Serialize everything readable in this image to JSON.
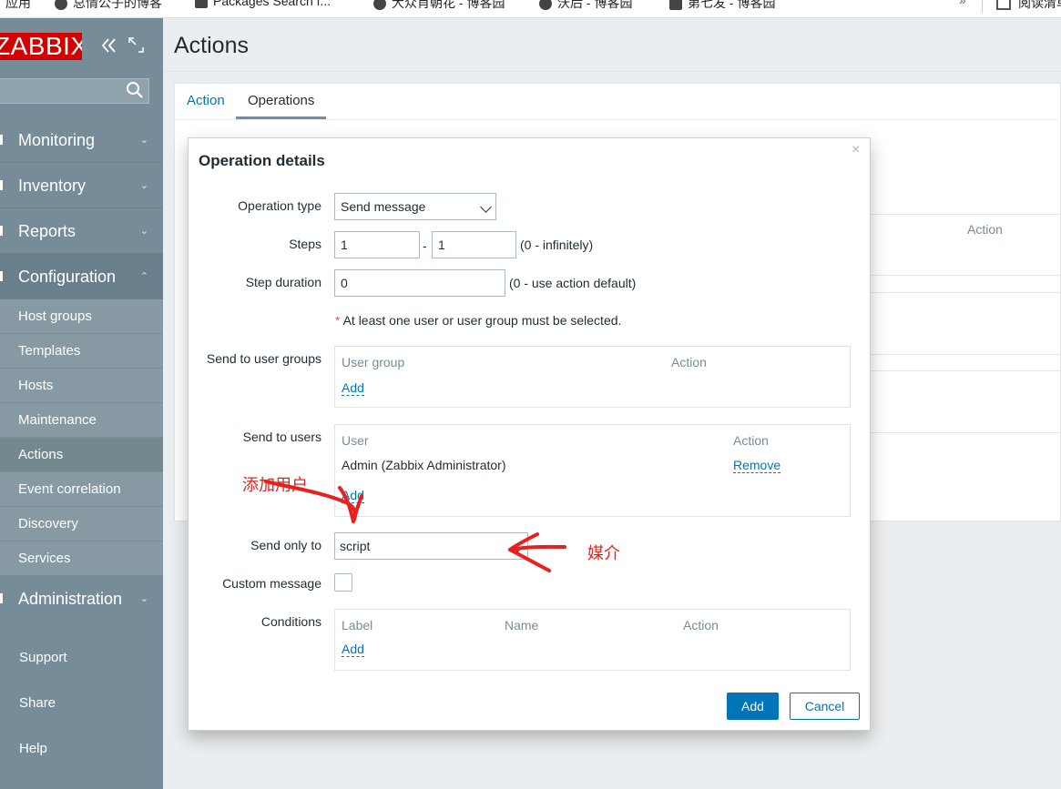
{
  "bookmarks": {
    "items": [
      "应用",
      "总情公子的博客",
      "Packages Search f...",
      "大众肖朝花 - 博客园",
      "沃后 - 博客园",
      "第七发 - 博客园"
    ],
    "more": "»",
    "reading_list": "阅读清单"
  },
  "sidebar": {
    "logo": "ZABBIX",
    "search_value": "",
    "sections": {
      "monitoring": "Monitoring",
      "inventory": "Inventory",
      "reports": "Reports",
      "configuration": "Configuration",
      "administration": "Administration"
    },
    "config_items": [
      "Host groups",
      "Templates",
      "Hosts",
      "Maintenance",
      "Actions",
      "Event correlation",
      "Discovery",
      "Services"
    ],
    "footer": [
      "Support",
      "Share",
      "Help"
    ]
  },
  "page": {
    "title": "Actions",
    "tabs": [
      "Action",
      "Operations"
    ],
    "bg_action_header": "Action"
  },
  "dialog": {
    "title": "Operation details",
    "close": "×",
    "operation_type_label": "Operation type",
    "operation_type_value": "Send message",
    "steps_label": "Steps",
    "steps_from": "1",
    "steps_dash": "-",
    "steps_to": "1",
    "steps_hint": "(0 - infinitely)",
    "step_duration_label": "Step duration",
    "step_duration_value": "0",
    "step_duration_hint": "(0 - use action default)",
    "required_star": "*",
    "required_note": "At least one user or user group must be selected.",
    "user_groups_label": "Send to user groups",
    "user_groups_headers": [
      "User group",
      "Action"
    ],
    "users_label": "Send to users",
    "users_headers": [
      "User",
      "Action"
    ],
    "users_rows": [
      {
        "user": "Admin (Zabbix Administrator)",
        "action": "Remove"
      }
    ],
    "add_link": "Add",
    "send_only_to_label": "Send only to",
    "send_only_to_value": "script",
    "custom_message_label": "Custom message",
    "conditions_label": "Conditions",
    "conditions_headers": [
      "Label",
      "Name",
      "Action"
    ],
    "add_button": "Add",
    "cancel_button": "Cancel"
  },
  "annotations": {
    "add_user": "添加用户",
    "media": "媒介",
    "color": "#e8211f"
  }
}
